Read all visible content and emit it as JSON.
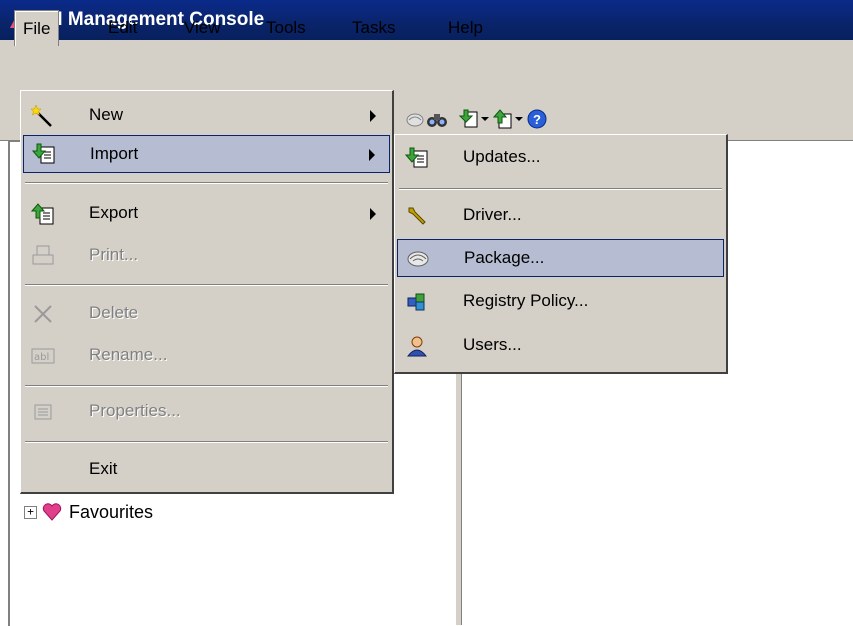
{
  "window": {
    "title": "RM Management Console"
  },
  "menubar": {
    "file": "File",
    "edit": "Edit",
    "view": "View",
    "tools": "Tools",
    "tasks": "Tasks",
    "help": "Help"
  },
  "file_menu": {
    "new": "New",
    "import": "Import",
    "export": "Export",
    "print": "Print...",
    "delete": "Delete",
    "rename": "Rename...",
    "properties": "Properties...",
    "exit": "Exit"
  },
  "import_submenu": {
    "updates": "Updates...",
    "driver": "Driver...",
    "package": "Package...",
    "registry_policy": "Registry Policy...",
    "users": "Users..."
  },
  "tree": {
    "favourites": "Favourites",
    "favourites_expander": "+"
  },
  "colors": {
    "titlebar": "#0a246a",
    "menu_bg": "#d4d0c8",
    "highlight": "#b6bdd2",
    "highlight_border": "#0a246a"
  },
  "icons": {
    "app": "rm-logo-icon",
    "new": "magic-wand-icon",
    "import": "import-green-arrow-icon",
    "export": "export-green-arrow-icon",
    "print": "printer-icon",
    "delete": "x-delete-icon",
    "rename": "rename-abl-icon",
    "properties": "properties-icon",
    "driver": "wrench-icon",
    "package": "package-handshake-icon",
    "registry_policy": "registry-policy-icon",
    "users": "user-icon",
    "favourites": "heart-icon"
  }
}
